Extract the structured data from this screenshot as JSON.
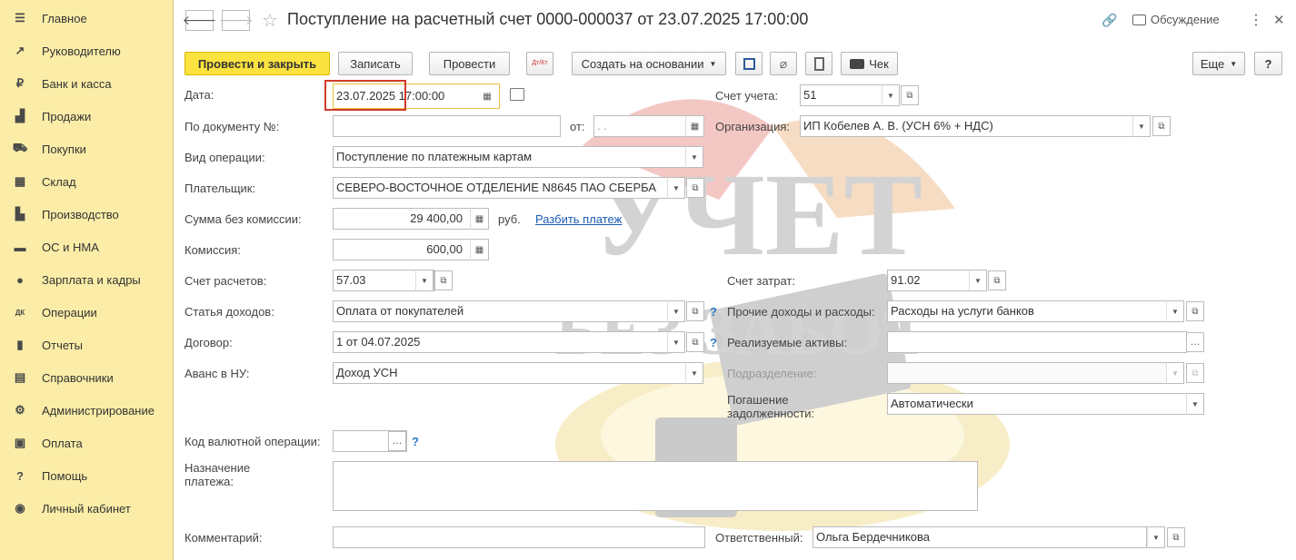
{
  "sidebar": {
    "items": [
      {
        "label": "Главное",
        "icon": "menu-icon",
        "glyph": "☰"
      },
      {
        "label": "Руководителю",
        "icon": "trend-icon",
        "glyph": "↗"
      },
      {
        "label": "Банк и касса",
        "icon": "ruble-icon",
        "glyph": "₽"
      },
      {
        "label": "Продажи",
        "icon": "bag-icon",
        "glyph": "▟"
      },
      {
        "label": "Покупки",
        "icon": "cart-icon",
        "glyph": "⛟"
      },
      {
        "label": "Склад",
        "icon": "warehouse-icon",
        "glyph": "▦"
      },
      {
        "label": "Производство",
        "icon": "factory-icon",
        "glyph": "▙"
      },
      {
        "label": "ОС и НМА",
        "icon": "truck-icon",
        "glyph": "▬"
      },
      {
        "label": "Зарплата и кадры",
        "icon": "person-icon",
        "glyph": "●"
      },
      {
        "label": "Операции",
        "icon": "dt-kt-icon",
        "glyph": "ДК"
      },
      {
        "label": "Отчеты",
        "icon": "bar-chart-icon",
        "glyph": "▮"
      },
      {
        "label": "Справочники",
        "icon": "books-icon",
        "glyph": "▤"
      },
      {
        "label": "Администрирование",
        "icon": "gear-icon",
        "glyph": "⚙"
      },
      {
        "label": "Оплата",
        "icon": "wallet-icon",
        "glyph": "▣"
      },
      {
        "label": "Помощь",
        "icon": "question-icon",
        "glyph": "?"
      },
      {
        "label": "Личный кабинет",
        "icon": "account-icon",
        "glyph": "◉"
      }
    ]
  },
  "header": {
    "title": "Поступление на расчетный счет 0000-000037 от 23.07.2025 17:00:00",
    "discussion": "Обсуждение",
    "back": "🡐",
    "forward": "🡒",
    "star": "☆",
    "link": "🔗",
    "more": "⋮",
    "close": "✕"
  },
  "toolbar": {
    "post_close": "Провести и закрыть",
    "save": "Записать",
    "post": "Провести",
    "create_based": "Создать на основании",
    "check": "Чек",
    "more": "Еще",
    "help": "?",
    "dtkt": "Дт/Кт"
  },
  "form": {
    "date_label": "Дата:",
    "date_value": "23.07.2025 17:00:00",
    "doc_no_label": "По документу №:",
    "doc_no_value": "",
    "from_label": "от:",
    "from_value": " .  .",
    "op_type_label": "Вид операции:",
    "op_type_value": "Поступление по платежным картам",
    "payer_label": "Плательщик:",
    "payer_value": "СЕВЕРО-ВОСТОЧНОЕ ОТДЕЛЕНИЕ N8645 ПАО СБЕРБА",
    "amount_label": "Сумма без комиссии:",
    "amount_value": "29 400,00",
    "currency": "руб.",
    "split_link": "Разбить платеж",
    "commission_label": "Комиссия:",
    "commission_value": "600,00",
    "settle_acc_label": "Счет расчетов:",
    "settle_acc_value": "57.03",
    "income_item_label": "Статья доходов:",
    "income_item_value": "Оплата от покупателей",
    "contract_label": "Договор:",
    "contract_value": "1 от 04.07.2025",
    "advance_label": "Аванс в НУ:",
    "advance_value": "Доход УСН",
    "currency_op_label": "Код валютной операции:",
    "currency_op_value": "",
    "purpose_label": "Назначение платежа:",
    "purpose_value": "",
    "comment_label": "Комментарий:",
    "comment_value": "",
    "account_label": "Счет учета:",
    "account_value": "51",
    "org_label": "Организация:",
    "org_value": "ИП Кобелев А. В. (УСН 6% + НДС)",
    "cost_acc_label": "Счет затрат:",
    "cost_acc_value": "91.02",
    "other_label": "Прочие доходы и расходы:",
    "other_value": "Расходы на услуги банков",
    "assets_label": "Реализуемые активы:",
    "assets_value": "",
    "division_label": "Подразделение:",
    "division_value": "",
    "debt_label": "Погашение задолженности:",
    "debt_value": "Автоматически",
    "responsible_label": "Ответственный:",
    "responsible_value": "Ольга Бердечникова"
  },
  "watermark": {
    "line1": "УЧЕТ",
    "line2": "БЕЗ ЗАБОТ"
  },
  "colors": {
    "sidebar": "#fbeda7",
    "primary": "#fce23f",
    "highlight_box": "#d03a2a",
    "link": "#1a5bb8"
  }
}
